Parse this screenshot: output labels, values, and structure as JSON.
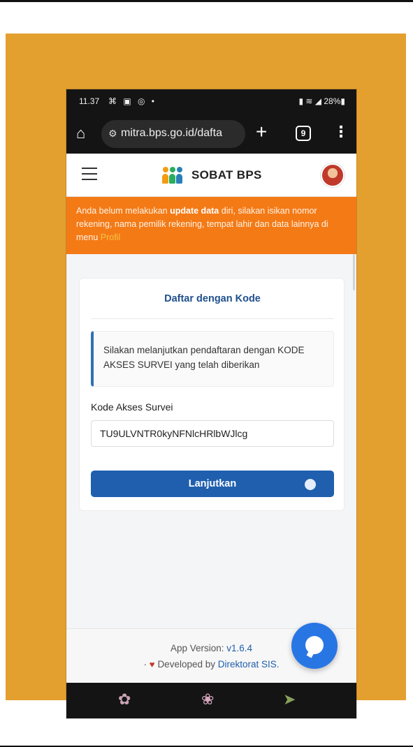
{
  "status_bar": {
    "time": "11.37",
    "left_icons": "⌘ ▣ ◎ •",
    "right_status": "▮ ≋ ◢ 28%▮"
  },
  "browser": {
    "url": "mitra.bps.go.id/dafta",
    "tab_count": "9",
    "home_icon": "home-icon",
    "more_icon": "more-vertical-icon"
  },
  "header": {
    "title": "SOBAT BPS"
  },
  "notice": {
    "text_before": "Anda belum melakukan ",
    "bold": "update data",
    "text_after": " diri, silakan isikan nomor rekening, nama pemilik rekening, tempat lahir dan data lainnya di menu ",
    "link": "Profil"
  },
  "card": {
    "title": "Daftar dengan Kode",
    "info": "Silakan melanjutkan pendaftaran dengan KODE AKSES SURVEI yang telah diberikan",
    "field_label": "Kode Akses Survei",
    "field_value": "TU9ULVNTR0kyNFNlcHRlbWJlcg",
    "submit_label": "Lanjutkan"
  },
  "footer": {
    "version_label": "App Version: ",
    "version": "v1.6.4",
    "dev_bullet": "·",
    "dev_label": "Developed by ",
    "dev_org": "Direktorat SIS."
  },
  "colors": {
    "notice_bg": "#f47a16",
    "primary": "#1f5fae",
    "frame": "#e4a02f"
  }
}
